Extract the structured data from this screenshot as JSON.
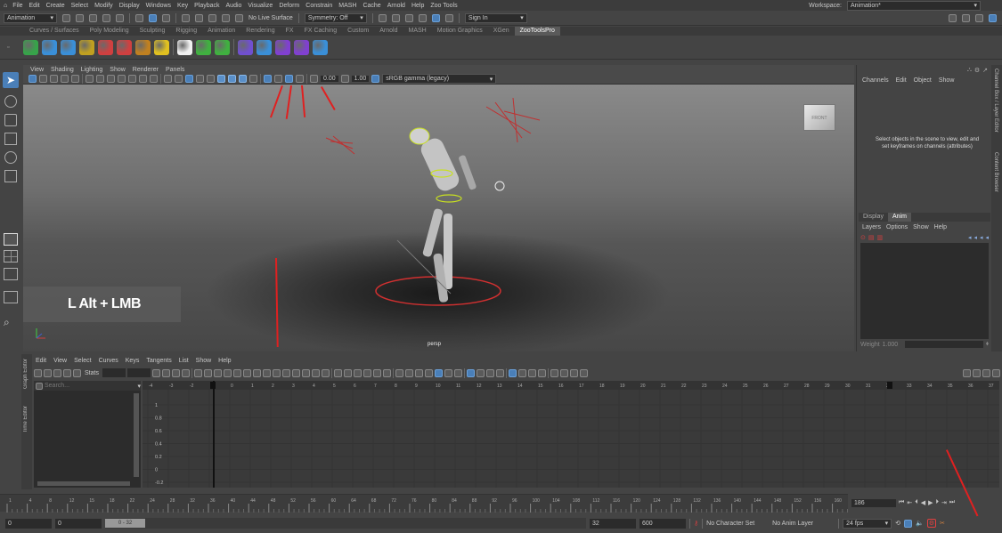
{
  "menubar": {
    "items": [
      "File",
      "Edit",
      "Create",
      "Select",
      "Modify",
      "Display",
      "Windows",
      "Key",
      "Playback",
      "Audio",
      "Visualize",
      "Deform",
      "Constrain",
      "MASH",
      "Cache",
      "Arnold",
      "Help",
      "Zoo Tools"
    ],
    "workspace_label": "Workspace:",
    "workspace_value": "Animation*"
  },
  "statusline": {
    "mode": "Animation",
    "live_surface": "No Live Surface",
    "symmetry": "Symmetry: Off",
    "sign_in": "Sign In"
  },
  "shelf": {
    "tabs": [
      "Curves / Surfaces",
      "Poly Modeling",
      "Sculpting",
      "Rigging",
      "Animation",
      "Rendering",
      "FX",
      "FX Caching",
      "Custom",
      "Arnold",
      "MASH",
      "Motion Graphics",
      "XGen",
      "ZooToolsPro"
    ],
    "active_tab": "ZooToolsPro",
    "icons": [
      "#37a34a",
      "#3a8fd8",
      "#3a8fd8",
      "#c0a020",
      "#d04040",
      "#d04040",
      "#c08020",
      "#e0c020",
      "#f0f0f0",
      "#40b040",
      "#40b040",
      "#7050d0",
      "#3a8fd8",
      "#8040d0",
      "#8040d0",
      "#3a8fd8"
    ]
  },
  "viewport": {
    "menu": [
      "View",
      "Shading",
      "Lighting",
      "Show",
      "Renderer",
      "Panels"
    ],
    "exposure": "0.00",
    "gamma": "1.00",
    "color_space": "sRGB gamma (legacy)",
    "camera_label": "persp",
    "viewcube_label": "FRONT",
    "overlay_text": "L Alt + LMB"
  },
  "channel_box": {
    "menu": [
      "Channels",
      "Edit",
      "Object",
      "Show"
    ],
    "hint": "Select objects in the scene to view, edit and set keyframes on channels (attributes)",
    "side_tabs": [
      "Channel Box / Layer Editor",
      "Content Browser"
    ]
  },
  "layer_editor": {
    "tabs": [
      "Display",
      "Anim"
    ],
    "active_tab": "Anim",
    "menu": [
      "Layers",
      "Options",
      "Show",
      "Help"
    ],
    "weight_label": "Weight",
    "weight_value": "1.000"
  },
  "graph_editor": {
    "menu": [
      "Edit",
      "View",
      "Select",
      "Curves",
      "Keys",
      "Tangents",
      "List",
      "Show",
      "Help"
    ],
    "stats_label": "Stats",
    "search_placeholder": "Search...",
    "side_tabs": [
      "Graph Editor",
      "Time Editor"
    ],
    "ruler": [
      "-4",
      "-3",
      "-2",
      "-1",
      "0",
      "1",
      "2",
      "3",
      "4",
      "5",
      "6",
      "7",
      "8",
      "9",
      "10",
      "11",
      "12",
      "13",
      "14",
      "15",
      "16",
      "17",
      "18",
      "19",
      "20",
      "21",
      "22",
      "23",
      "24",
      "25",
      "26",
      "27",
      "28",
      "29",
      "30",
      "31",
      "32",
      "33",
      "34",
      "35",
      "36",
      "37"
    ],
    "y_values": [
      "1",
      "0.8",
      "0.6",
      "0.4",
      "0.2",
      "0",
      "-0.2"
    ]
  },
  "timeslider": {
    "ticks": [
      "1",
      "4",
      "8",
      "12",
      "15",
      "18",
      "22",
      "24",
      "28",
      "32",
      "36",
      "40",
      "44",
      "48",
      "52",
      "56",
      "60",
      "64",
      "68",
      "72",
      "76",
      "80",
      "84",
      "88",
      "92",
      "96",
      "100",
      "104",
      "108",
      "112",
      "116",
      "120",
      "124",
      "128",
      "132",
      "136",
      "140",
      "144",
      "148",
      "152",
      "156",
      "160"
    ],
    "current_frame": "186"
  },
  "range": {
    "start": "0",
    "play_start": "0",
    "range_label": "0 - 32",
    "play_end": "32",
    "end": "600",
    "character_set": "No Character Set",
    "anim_layer": "No Anim Layer",
    "fps": "24 fps"
  },
  "colors": {
    "accent": "#4a7fb8",
    "arrow": "#e02020",
    "active_tab": "#5a5a5a"
  }
}
